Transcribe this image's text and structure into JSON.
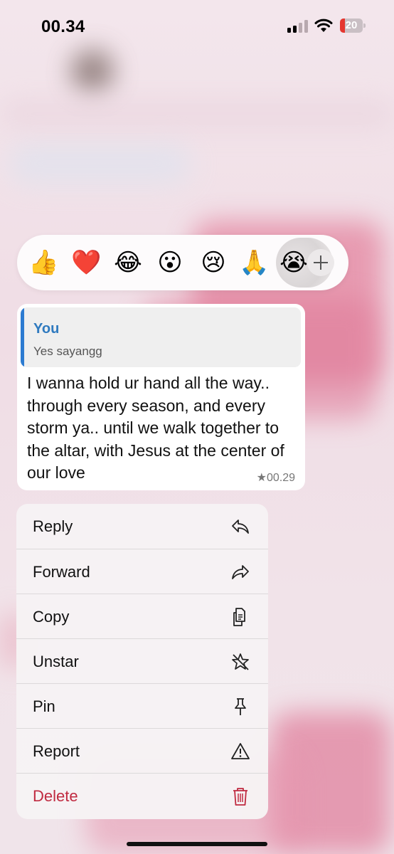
{
  "status_bar": {
    "time": "00.34",
    "battery_level": "20",
    "signal_bars_active": 2,
    "signal_bars_total": 4
  },
  "reaction_bar": {
    "emojis": [
      "👍",
      "❤️",
      "😂",
      "😮",
      "😢",
      "🙏",
      "😭"
    ],
    "add_icon": "plus-icon"
  },
  "message": {
    "quote_author": "You",
    "quote_text": "Yes sayangg",
    "text": "I wanna hold ur hand all the way.. through every season, and every storm ya.. until we walk together to the altar, with Jesus at the center of our love",
    "star_icon": "★",
    "time": "00.29"
  },
  "menu": {
    "items": [
      {
        "label": "Reply",
        "icon": "reply-icon"
      },
      {
        "label": "Forward",
        "icon": "forward-icon"
      },
      {
        "label": "Copy",
        "icon": "copy-icon"
      },
      {
        "label": "Unstar",
        "icon": "unstar-icon"
      },
      {
        "label": "Pin",
        "icon": "pin-icon"
      },
      {
        "label": "Report",
        "icon": "report-icon"
      },
      {
        "label": "Delete",
        "icon": "trash-icon"
      }
    ]
  },
  "colors": {
    "accent": "#2f7abf",
    "danger": "#c02a40",
    "battery": "#e5362f"
  }
}
